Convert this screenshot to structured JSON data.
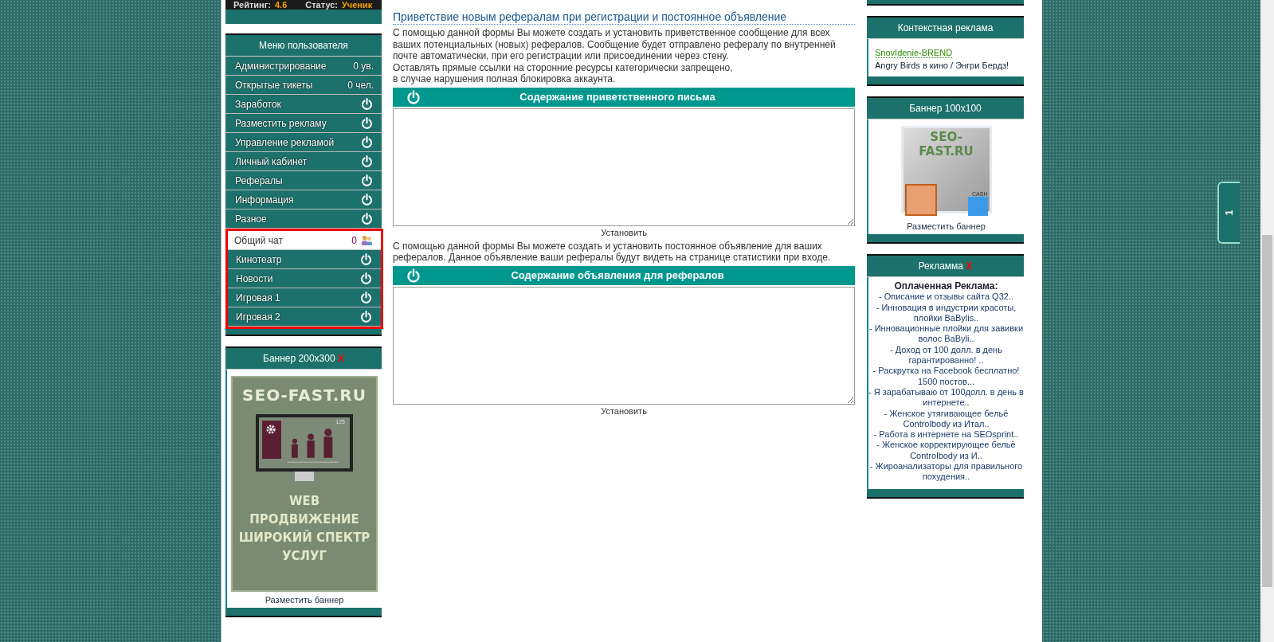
{
  "user_bar": {
    "rating_label": "Рейтинг:",
    "rating": "4.6",
    "status_label": "Статус:",
    "status": "Ученик"
  },
  "menu": {
    "title": "Меню пользователя",
    "items": [
      {
        "label": "Администрирование",
        "kind": "count",
        "count": "0 ув."
      },
      {
        "label": "Открытые тикеты",
        "kind": "count",
        "count": "0 чел."
      },
      {
        "label": "Заработок",
        "kind": "toggle"
      },
      {
        "label": "Разместить рекламу",
        "kind": "toggle"
      },
      {
        "label": "Управление рекламой",
        "kind": "toggle"
      },
      {
        "label": "Личный кабинет",
        "kind": "toggle"
      },
      {
        "label": "Рефералы",
        "kind": "toggle"
      },
      {
        "label": "Информация",
        "kind": "toggle"
      },
      {
        "label": "Разное",
        "kind": "toggle"
      }
    ],
    "highlighted_items": [
      {
        "label": "Общий чат",
        "kind": "chat",
        "count": "0"
      },
      {
        "label": "Кинотеатр",
        "kind": "toggle"
      },
      {
        "label": "Новости",
        "kind": "toggle"
      },
      {
        "label": "Игровая 1",
        "kind": "toggle"
      },
      {
        "label": "Игровая 2",
        "kind": "toggle"
      }
    ]
  },
  "banner_left": {
    "title": "Баннер 200x300",
    "close": "X",
    "logo": "SEO-FAST.RU",
    "screen_number": "125",
    "lines": [
      "WEB",
      "ПРОДВИЖЕНИЕ",
      "ШИРОКИЙ СПЕКТР",
      "УСЛУГ"
    ],
    "link": "Разместить баннер"
  },
  "main": {
    "title": "Приветствие новым рефералам при регистрации и постоянное объявление",
    "forms": [
      {
        "intro": [
          "С помощью данной формы Вы можете создать и установить приветственное сообщение для всех ваших потенциальных (новых) рефералов. Сообщение будет отправлено рефералу по внутренней почте автоматически, при его регистрации или присоединении через стену.",
          "Оставлять прямые ссылки на сторонние ресурсы категорически запрещено,",
          "в случае нарушения полная блокировка аккаунта."
        ],
        "header": "Содержание приветственного письма",
        "button": "Установить"
      },
      {
        "intro": [
          "С помощью данной формы Вы можете создать и установить постоянное объявление для ваших рефералов. Данное объявление ваши рефералы будут видеть на странице статистики при входе."
        ],
        "header": "Содержание объявления для рефералов",
        "button": "Установить"
      }
    ]
  },
  "context_ads": {
    "title": "Контекстная реклама",
    "link": "SnovIdenie-BREND",
    "text": "Angry Birds в кино / Энгри Бердз!"
  },
  "banner_right": {
    "title": "Баннер 100x100",
    "logo": "SEO-FAST.RU",
    "cash": "CASH",
    "link": "Разместить баннер"
  },
  "ads": {
    "title": "Рекламма",
    "close": "X",
    "heading": "Оплаченная Реклама:",
    "items": [
      "- Описание и отзывы сайта Q32..",
      "- Инновация в индустрии красоты, плойки BaBylis..",
      "- Инновационные плойки для завивки волос BaByli..",
      "- Доход от 100 долл. в день гарантированно! ..",
      "- Раскрутка на Facebook бесплатно! 1500 постов...",
      "- Я зарабатываю от 100долл. в день в интернете..",
      "- Женское утягивающее бельё Controlbody из Итал..",
      "- Работа в интернете на SEOsprint..",
      "- Женское корректирующее бельё Controlbody из И..",
      "- Жироанализаторы для правильного похудения.."
    ]
  },
  "side_tab": {
    "label": "1"
  }
}
